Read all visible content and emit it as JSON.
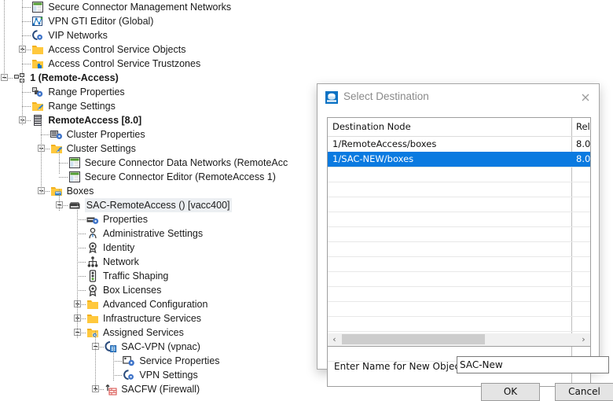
{
  "tree": {
    "nodes": [
      {
        "label": "Secure Connector Management Networks",
        "icon": "network-table-icon",
        "indent": 4,
        "expander": "none",
        "bold": false,
        "selected": false
      },
      {
        "label": "VPN GTI Editor (Global)",
        "icon": "vpn-gti-icon",
        "indent": 4,
        "expander": "none",
        "bold": false,
        "selected": false
      },
      {
        "label": "VIP Networks",
        "icon": "vip-network-icon",
        "indent": 4,
        "expander": "none",
        "bold": false,
        "selected": false
      },
      {
        "label": "Access Control Service Objects",
        "icon": "folder-icon",
        "indent": 4,
        "expander": "plus",
        "bold": false,
        "selected": false
      },
      {
        "label": "Access Control Service Trustzones",
        "icon": "folder-puzzle-icon",
        "indent": 4,
        "expander": "none",
        "bold": false,
        "selected": false
      },
      {
        "label": "1 (Remote-Access)",
        "icon": "range-icon",
        "indent": 2,
        "expander": "minus",
        "bold": true,
        "selected": false
      },
      {
        "label": "Range Properties",
        "icon": "range-properties-icon",
        "indent": 4,
        "expander": "none",
        "bold": false,
        "selected": false
      },
      {
        "label": "Range Settings",
        "icon": "folder-pencil-icon",
        "indent": 4,
        "expander": "none",
        "bold": false,
        "selected": false
      },
      {
        "label": "RemoteAccess [8.0]",
        "icon": "cluster-icon",
        "indent": 4,
        "expander": "minus",
        "bold": true,
        "selected": false
      },
      {
        "label": "Cluster Properties",
        "icon": "cluster-properties-icon",
        "indent": 6,
        "expander": "none",
        "bold": false,
        "selected": false
      },
      {
        "label": "Cluster Settings",
        "icon": "folder-pencil-icon",
        "indent": 6,
        "expander": "minus",
        "bold": false,
        "selected": false
      },
      {
        "label": "Secure Connector Data Networks (RemoteAcc",
        "icon": "network-table-icon",
        "indent": 8,
        "expander": "none",
        "bold": false,
        "selected": false
      },
      {
        "label": "Secure Connector Editor (RemoteAccess 1)",
        "icon": "network-table-icon",
        "indent": 8,
        "expander": "none",
        "bold": false,
        "selected": false
      },
      {
        "label": "Boxes",
        "icon": "folder-box-icon",
        "indent": 6,
        "expander": "minus",
        "bold": false,
        "selected": false
      },
      {
        "label": "SAC-RemoteAccess () [vacc400]",
        "icon": "box-icon",
        "indent": 8,
        "expander": "minus",
        "bold": false,
        "selected": true
      },
      {
        "label": "Properties",
        "icon": "box-properties-icon",
        "indent": 10,
        "expander": "none",
        "bold": false,
        "selected": false
      },
      {
        "label": "Administrative Settings",
        "icon": "person-icon",
        "indent": 10,
        "expander": "none",
        "bold": false,
        "selected": false
      },
      {
        "label": "Identity",
        "icon": "identity-badge-icon",
        "indent": 10,
        "expander": "none",
        "bold": false,
        "selected": false
      },
      {
        "label": "Network",
        "icon": "network-tree-icon",
        "indent": 10,
        "expander": "none",
        "bold": false,
        "selected": false
      },
      {
        "label": "Traffic Shaping",
        "icon": "traffic-light-icon",
        "indent": 10,
        "expander": "none",
        "bold": false,
        "selected": false
      },
      {
        "label": "Box Licenses",
        "icon": "license-seal-icon",
        "indent": 10,
        "expander": "none",
        "bold": false,
        "selected": false
      },
      {
        "label": "Advanced Configuration",
        "icon": "folder-icon",
        "indent": 10,
        "expander": "plus",
        "bold": false,
        "selected": false
      },
      {
        "label": "Infrastructure Services",
        "icon": "folder-icon",
        "indent": 10,
        "expander": "plus",
        "bold": false,
        "selected": false
      },
      {
        "label": "Assigned Services",
        "icon": "folder-gear-icon",
        "indent": 10,
        "expander": "minus",
        "bold": false,
        "selected": false
      },
      {
        "label": "SAC-VPN (vpnac)",
        "icon": "vpn-service-icon",
        "indent": 12,
        "expander": "minus",
        "bold": false,
        "selected": false
      },
      {
        "label": "Service Properties",
        "icon": "service-properties-icon",
        "indent": 14,
        "expander": "none",
        "bold": false,
        "selected": false
      },
      {
        "label": "VPN Settings",
        "icon": "vip-network-icon",
        "indent": 14,
        "expander": "none",
        "bold": false,
        "selected": false
      },
      {
        "label": "SACFW (Firewall)",
        "icon": "firewall-icon",
        "indent": 12,
        "expander": "plus",
        "bold": false,
        "selected": false
      }
    ]
  },
  "dialog": {
    "title": "Select Destination",
    "icon": "select-destination-icon",
    "close_label": "×",
    "list": {
      "columns": [
        "Destination Node",
        "Release"
      ],
      "rows": [
        {
          "node": "1/RemoteAccess/boxes",
          "release": "8.0",
          "selected": false
        },
        {
          "node": "1/SAC-NEW/boxes",
          "release": "8.0",
          "selected": true
        }
      ]
    },
    "scrollbar": {
      "left_arrow": "‹",
      "right_arrow": "›"
    },
    "name_label": "Enter Name for New Object",
    "name_value": "SAC-New",
    "name_placeholder": "",
    "ok_label": "OK",
    "cancel_label": "Cancel"
  },
  "colors": {
    "selection_blue": "#0a7ae0",
    "folder_yellow": "#f2b01e",
    "accent_blue": "#0b72c4",
    "tree_selection_gray": "#eceff2"
  }
}
